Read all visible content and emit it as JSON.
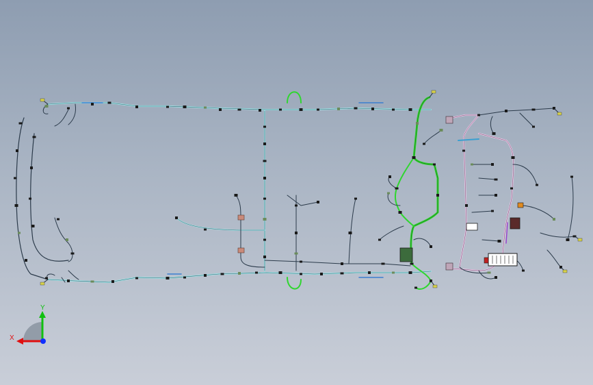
{
  "viewport": {
    "background_top": "#8e9db1",
    "background_bottom": "#c9ced8"
  },
  "colors": {
    "main_harness": "#9fe3e6",
    "dash_harness": "#2fd62f",
    "front_harness": "#e7c6e4",
    "wire": "#1e2b3a",
    "connector": "#1a1a1a",
    "clip": "#6b8c5b",
    "fuse_box": "#ffffff"
  },
  "triad": {
    "x_label": "X",
    "y_label": "Y",
    "x_color": "#e01010",
    "y_color": "#10c010",
    "z_color": "#1030ff",
    "origin_icon": "coordinate-triad-icon"
  }
}
